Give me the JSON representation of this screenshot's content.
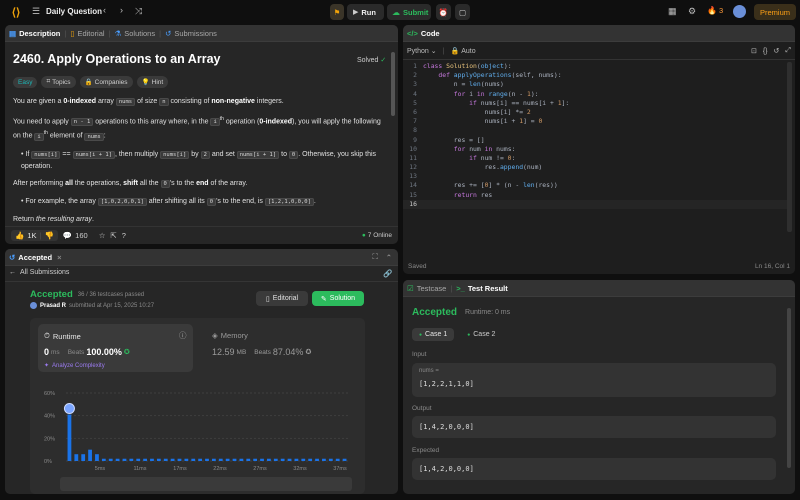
{
  "topbar": {
    "problem_list": "Daily Question",
    "run": "Run",
    "submit": "Submit",
    "streak": "3",
    "premium": "Premium"
  },
  "left_top": {
    "tabs": [
      "Description",
      "Editorial",
      "Solutions",
      "Submissions"
    ],
    "title": "2460. Apply Operations to an Array",
    "solved": "Solved",
    "tags": [
      "Easy",
      "Topics",
      "Companies",
      "Hint"
    ],
    "p1": {
      "a": "You are given a ",
      "b": "0-indexed",
      "c": " array ",
      "code1": "nums",
      "d": " of size ",
      "code2": "n",
      "e": " consisting of ",
      "f": "non-negative",
      "g": " integers."
    },
    "p2": {
      "a": "You need to apply ",
      "code1": "n - 1",
      "b": " operations to this array where, in the ",
      "code2": "i",
      "sup": "th",
      "c": " operation (",
      "d": "0-indexed",
      "e": "), you will apply the following on the ",
      "code3": "i",
      "sup2": "th",
      "f": " element of ",
      "code4": "nums",
      "g": ":"
    },
    "bullet1": {
      "a": "If ",
      "code1": "nums[i]",
      "b": " == ",
      "code2": "nums[i + 1]",
      "c": ", then multiply ",
      "code3": "nums[i]",
      "d": " by ",
      "code4": "2",
      "e": " and set ",
      "code5": "nums[i + 1]",
      "f": " to ",
      "code6": "0",
      "g": ". Otherwise, you skip this operation."
    },
    "p3": {
      "a": "After performing ",
      "b": "all",
      "c": " the operations, ",
      "d": "shift",
      "e": " all the ",
      "code1": "0",
      "f": "'s to the ",
      "g": "end",
      "h": " of the array."
    },
    "bullet2": {
      "a": "For example, the array ",
      "code1": "[1,0,2,0,0,1]",
      "b": " after shifting all its ",
      "code2": "0",
      "c": "'s to the end, is ",
      "code3": "[1,2,1,0,0,0]",
      "d": "."
    },
    "p4": {
      "a": "Return ",
      "b": "the resulting array",
      "c": "."
    },
    "footer": {
      "likes": "1K",
      "comments": "160",
      "online": "7 Online"
    }
  },
  "accepted_panel": {
    "tab": "Accepted",
    "all_submissions": "All Submissions",
    "status": "Accepted",
    "testcases": "36 / 36 testcases passed",
    "user": "Prasad R",
    "submitted": "submitted at Apr 15, 2025 10:27",
    "editorial_btn": "Editorial",
    "solution_btn": "Solution",
    "runtime_label": "Runtime",
    "runtime_value": "0",
    "runtime_unit": "ms",
    "runtime_beats_label": "Beats",
    "runtime_beats": "100.00%",
    "analyze": "Analyze Complexity",
    "memory_label": "Memory",
    "memory_value": "12.59",
    "memory_unit": "MB",
    "memory_beats_label": "Beats",
    "memory_beats": "87.04%"
  },
  "chart_data": {
    "type": "bar",
    "ylim": [
      0,
      60
    ],
    "y_ticks": [
      "60%",
      "40%",
      "20%",
      "0%"
    ],
    "x_ticks": [
      "5ms",
      "11ms",
      "17ms",
      "22ms",
      "27ms",
      "32ms",
      "37ms"
    ],
    "values": [
      41,
      6,
      6,
      10,
      6,
      2,
      2,
      2,
      2,
      2,
      2,
      2,
      2,
      2,
      2,
      2,
      2,
      2,
      2,
      2,
      2,
      2,
      2,
      2,
      2,
      2,
      2,
      2,
      2,
      2,
      2,
      2,
      2,
      2,
      2,
      2,
      2,
      2,
      2,
      2,
      2
    ],
    "highlight_index": 0,
    "color": "#1a73e8"
  },
  "code_panel": {
    "tab": "Code",
    "language": "Python",
    "auto": "Auto",
    "saved": "Saved",
    "cursor": "Ln 16, Col 1"
  },
  "test_panel": {
    "tabs": [
      "Testcase",
      "Test Result"
    ],
    "status": "Accepted",
    "runtime": "Runtime: 0 ms",
    "cases": [
      "Case 1",
      "Case 2"
    ],
    "input_label": "Input",
    "input_var": "nums =",
    "input_value": "[1,2,2,1,1,0]",
    "output_label": "Output",
    "output_value": "[1,4,2,0,0,0]",
    "expected_label": "Expected",
    "expected_value": "[1,4,2,0,0,0]"
  }
}
